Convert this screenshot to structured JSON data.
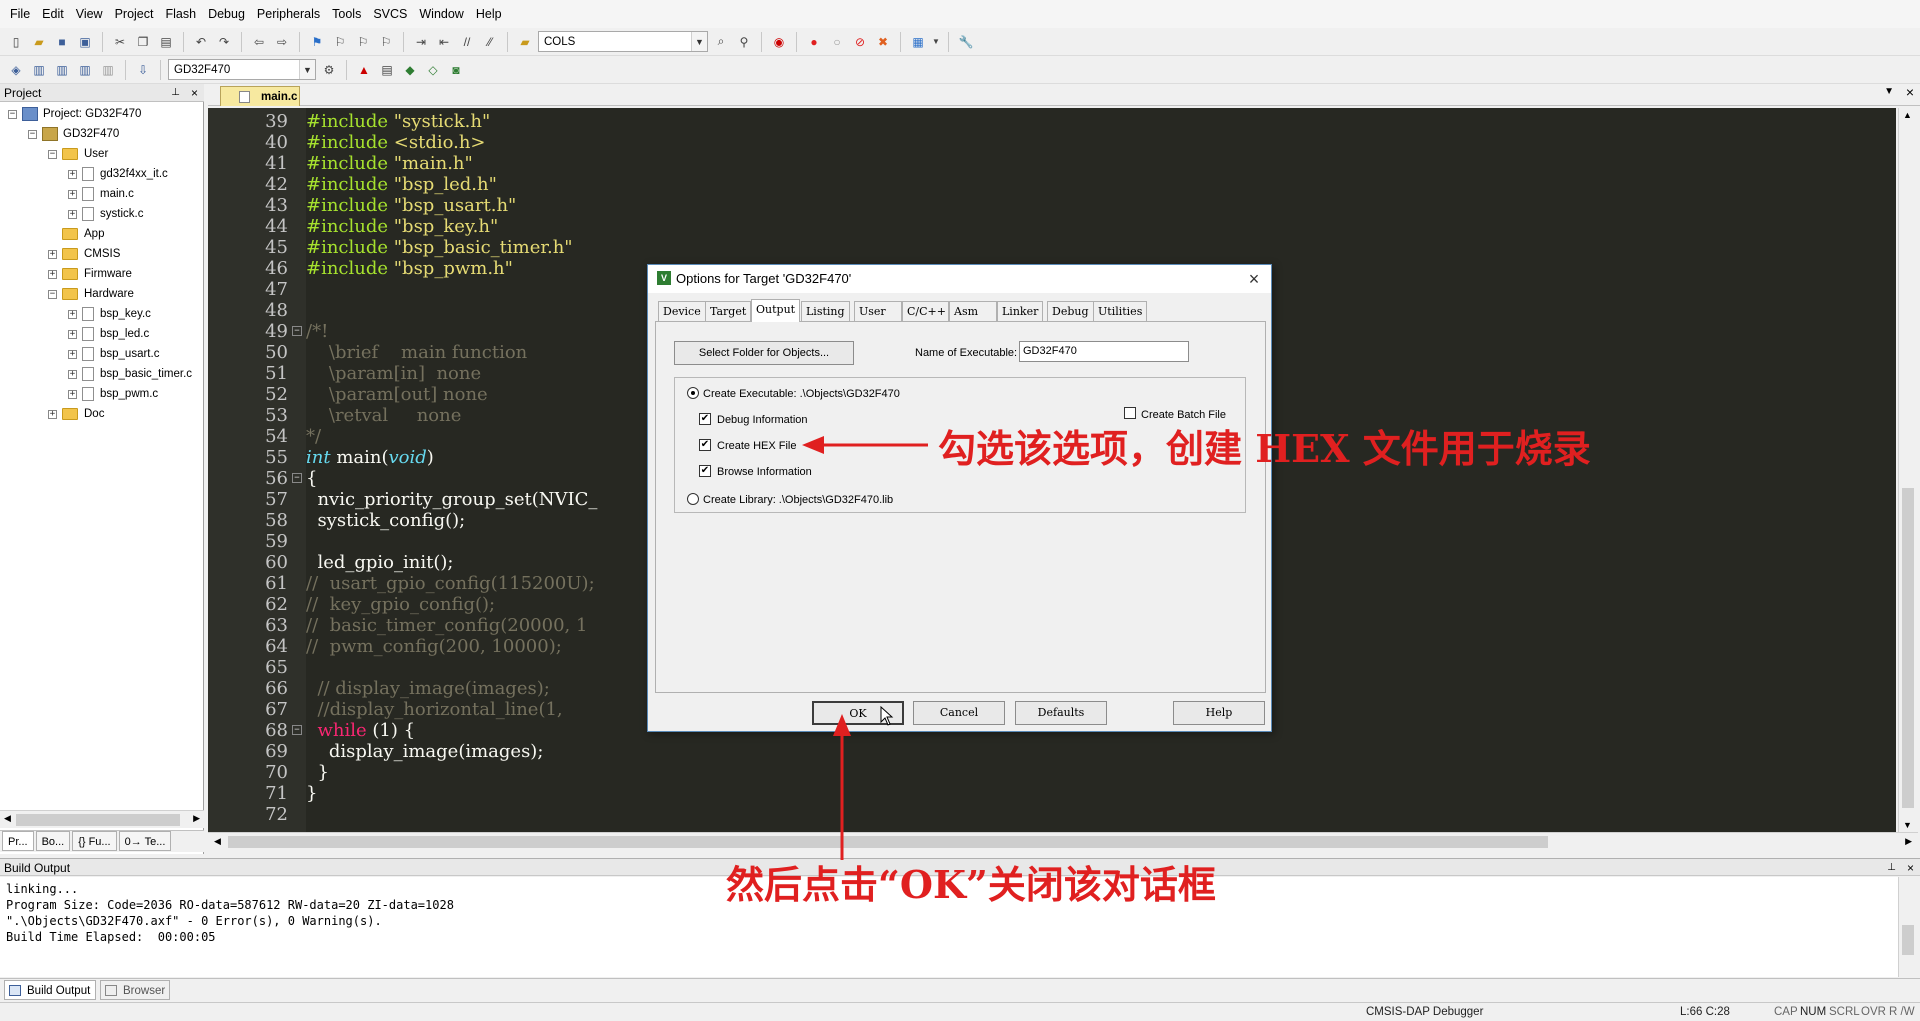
{
  "menu": [
    "File",
    "Edit",
    "View",
    "Project",
    "Flash",
    "Debug",
    "Peripherals",
    "Tools",
    "SVCS",
    "Window",
    "Help"
  ],
  "toolbar1": {
    "find_combo": "COLS"
  },
  "toolbar2": {
    "target_combo": "GD32F470"
  },
  "project": {
    "title": "Project",
    "root": "Project: GD32F470",
    "target": "GD32F470",
    "groups": {
      "user": "User",
      "user_files": [
        "gd32f4xx_it.c",
        "main.c",
        "systick.c"
      ],
      "app": "App",
      "cmsis": "CMSIS",
      "firmware": "Firmware",
      "hardware": "Hardware",
      "hardware_files": [
        "bsp_key.c",
        "bsp_led.c",
        "bsp_usart.c",
        "bsp_basic_timer.c",
        "bsp_pwm.c"
      ],
      "doc": "Doc"
    },
    "tabs": [
      "Pr...",
      "Bo...",
      "{} Fu...",
      "0→ Te..."
    ]
  },
  "editor": {
    "tab": "main.c",
    "lines": [
      {
        "n": "39",
        "t": "#include \"systick.h\""
      },
      {
        "n": "40",
        "t": "#include <stdio.h>"
      },
      {
        "n": "41",
        "t": "#include \"main.h\""
      },
      {
        "n": "42",
        "t": "#include \"bsp_led.h\""
      },
      {
        "n": "43",
        "t": "#include \"bsp_usart.h\""
      },
      {
        "n": "44",
        "t": "#include \"bsp_key.h\""
      },
      {
        "n": "45",
        "t": "#include \"bsp_basic_timer.h\""
      },
      {
        "n": "46",
        "t": "#include \"bsp_pwm.h\""
      },
      {
        "n": "47",
        "t": ""
      },
      {
        "n": "48",
        "t": ""
      },
      {
        "n": "49",
        "t": "/*!"
      },
      {
        "n": "50",
        "t": "    \\brief    main function"
      },
      {
        "n": "51",
        "t": "    \\param[in]  none"
      },
      {
        "n": "52",
        "t": "    \\param[out] none"
      },
      {
        "n": "53",
        "t": "    \\retval     none"
      },
      {
        "n": "54",
        "t": "*/"
      },
      {
        "n": "55",
        "t": "int main(void)"
      },
      {
        "n": "56",
        "t": "{"
      },
      {
        "n": "57",
        "t": "  nvic_priority_group_set(NVIC_"
      },
      {
        "n": "58",
        "t": "  systick_config();"
      },
      {
        "n": "59",
        "t": ""
      },
      {
        "n": "60",
        "t": "  led_gpio_init();"
      },
      {
        "n": "61",
        "t": "//  usart_gpio_config(115200U);"
      },
      {
        "n": "62",
        "t": "//  key_gpio_config();"
      },
      {
        "n": "63",
        "t": "//  basic_timer_config(20000, 1"
      },
      {
        "n": "64",
        "t": "//  pwm_config(200, 10000);"
      },
      {
        "n": "65",
        "t": ""
      },
      {
        "n": "66",
        "t": "  // display_image(images);"
      },
      {
        "n": "67",
        "t": "  //display_horizontal_line(1,"
      },
      {
        "n": "68",
        "t": "  while (1) {"
      },
      {
        "n": "69",
        "t": "    display_image(images);"
      },
      {
        "n": "70",
        "t": "  }"
      },
      {
        "n": "71",
        "t": "}"
      },
      {
        "n": "72",
        "t": ""
      }
    ]
  },
  "build": {
    "title": "Build Output",
    "lines": [
      "linking...",
      "Program Size: Code=2036 RO-data=587612 RW-data=20 ZI-data=1028",
      "\".\\Objects\\GD32F470.axf\" - 0 Error(s), 0 Warning(s).",
      "Build Time Elapsed:  00:00:05"
    ],
    "tabs": [
      "Build Output",
      "Browser"
    ]
  },
  "status": {
    "debugger": "CMSIS-DAP Debugger",
    "position": "L:66 C:28",
    "caps": "CAP",
    "num": "NUM",
    "scrl": "SCRL",
    "ovr": "OVR",
    "rw": "R /W"
  },
  "dialog": {
    "title": "Options for Target 'GD32F470'",
    "tabs": [
      "Device",
      "Target",
      "Output",
      "Listing",
      "User",
      "C/C++",
      "Asm",
      "Linker",
      "Debug",
      "Utilities"
    ],
    "active_tab": "Output",
    "select_folder": "Select Folder for Objects...",
    "name_exec_label": "Name of Executable:",
    "name_exec_value": "GD32F470",
    "create_exec": "Create Executable:  .\\Objects\\GD32F470",
    "debug_info": "Debug Information",
    "create_hex": "Create HEX File",
    "browse_info": "Browse Information",
    "create_batch": "Create Batch File",
    "create_lib": "Create Library:  .\\Objects\\GD32F470.lib",
    "ok": "OK",
    "cancel": "Cancel",
    "defaults": "Defaults",
    "help": "Help"
  },
  "annotations": {
    "hex_note": "勾选该选项，创建 HEX 文件用于烧录",
    "ok_note": "然后点击“OK”关闭该对话框"
  },
  "colors": {
    "annotation": "#e02020",
    "editor_bg": "#272822"
  }
}
